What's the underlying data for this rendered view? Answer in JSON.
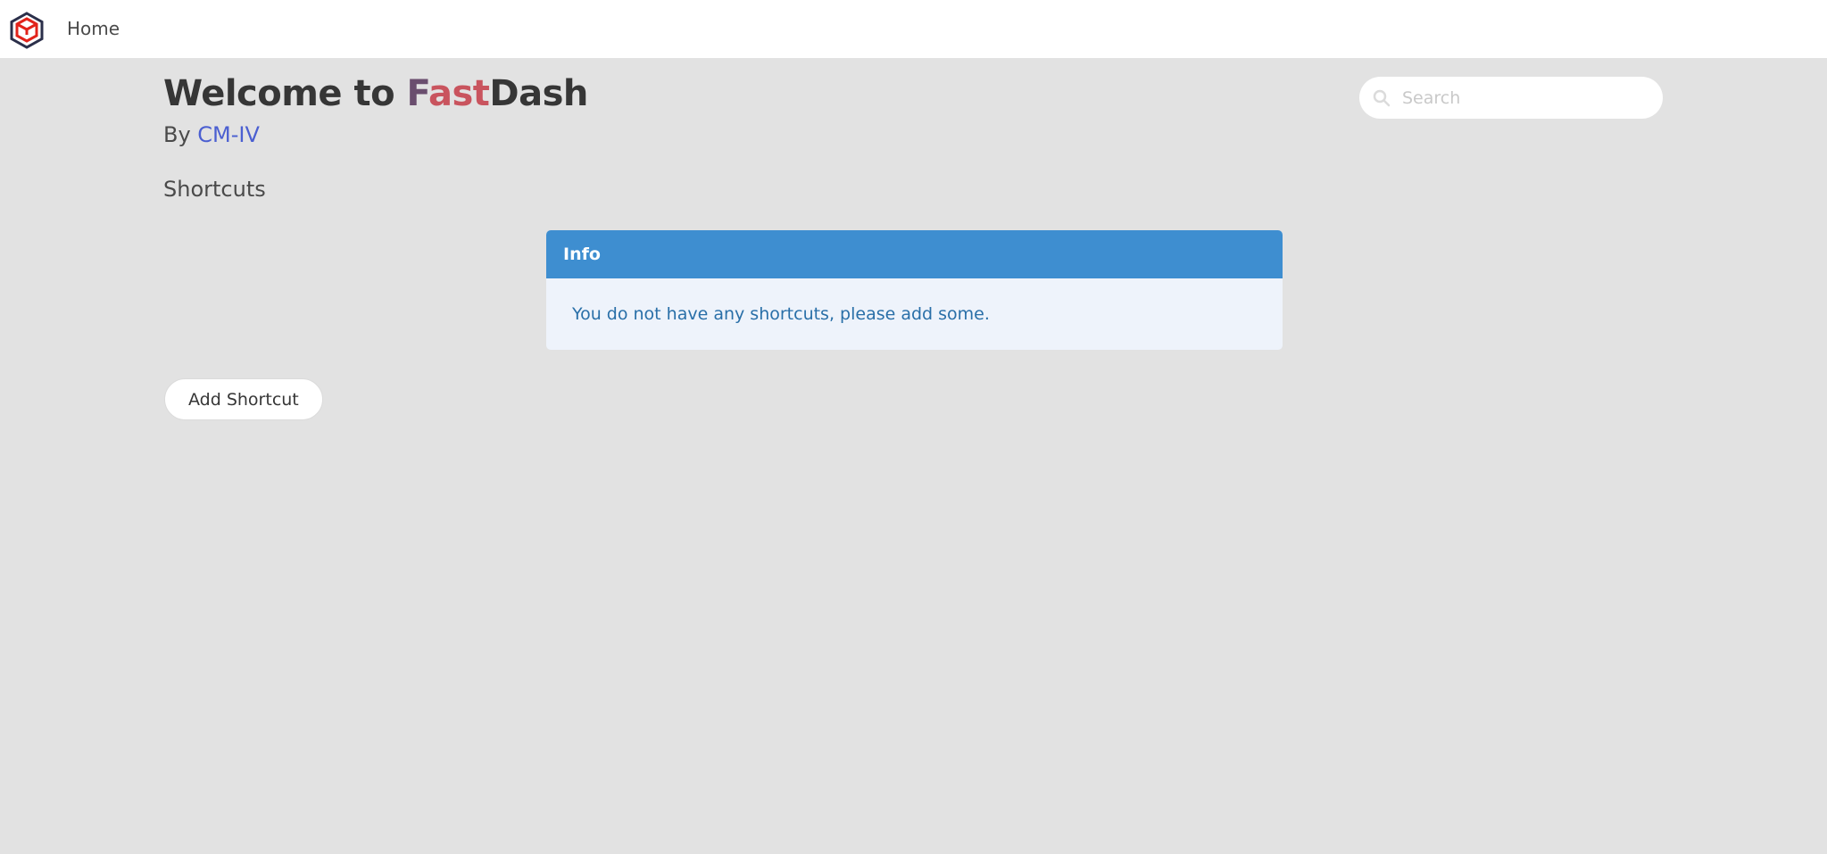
{
  "navbar": {
    "logo_icon": "fastdash-logo-icon",
    "home_label": "Home"
  },
  "header": {
    "title_prefix": "Welcome to ",
    "title_fast_f": "F",
    "title_fast_rest": "ast",
    "title_dash": "Dash",
    "subtitle_prefix": "By ",
    "author_link": "CM-IV"
  },
  "search": {
    "placeholder": "Search",
    "icon": "search-icon",
    "value": ""
  },
  "shortcuts": {
    "section_title": "Shortcuts",
    "info_header": "Info",
    "info_message": "You do not have any shortcuts, please add some.",
    "add_button_label": "Add Shortcut"
  },
  "colors": {
    "background": "#e2e2e2",
    "info_header": "#3e8ed0",
    "info_body_bg": "#eef3fb",
    "info_text": "#296fa8",
    "link": "#4b5fd1",
    "fast_f": "#6a4e6e",
    "fast_rest": "#c9545e"
  }
}
